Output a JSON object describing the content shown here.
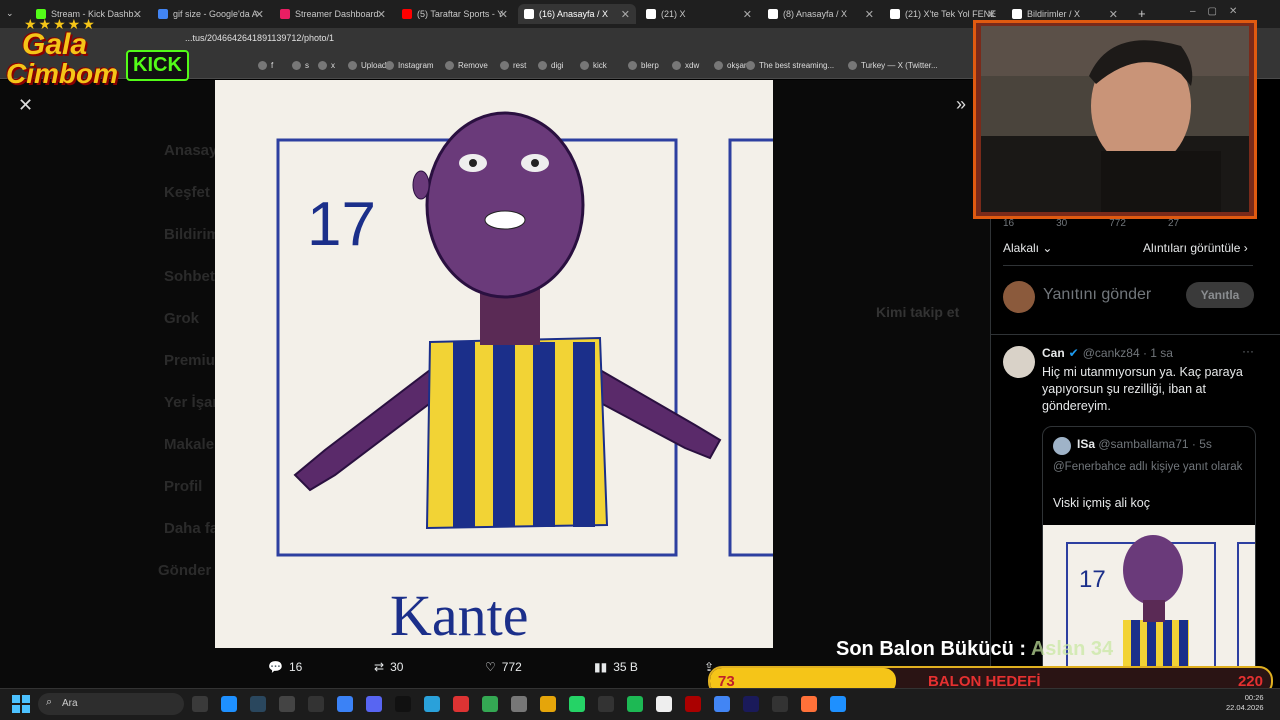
{
  "tabs": [
    {
      "label": "Stream - Kick Dashb...",
      "color": "#53fc18"
    },
    {
      "label": "gif size - Google'da A",
      "color": "#4285f4"
    },
    {
      "label": "Streamer Dashboard",
      "color": "#e91e63"
    },
    {
      "label": "(5) Taraftar Sports - Y",
      "color": "#ff0000"
    },
    {
      "label": "(16) Anasayfa / X",
      "color": "#ffffff"
    },
    {
      "label": "(21) X",
      "color": "#ffffff"
    },
    {
      "label": "(8) Anasayfa / X",
      "color": "#ffffff"
    },
    {
      "label": "(21) X'te Tek Yol FENE",
      "color": "#ffffff"
    },
    {
      "label": "Bildirimler / X",
      "color": "#ffffff"
    }
  ],
  "url": "...tus/2046642641891139712/photo/1",
  "bookmarks": [
    "f",
    "s",
    "x",
    "Upload",
    "Instagram",
    "Remove",
    "rest",
    "digi",
    "kick",
    "blerp",
    "xdw",
    "okşan",
    "The best streaming...",
    "Turkey — X (Twitter..."
  ],
  "logo": {
    "line1": "Gala",
    "line2": "Cimbom",
    "badge": "KICK"
  },
  "photo": {
    "number": "17",
    "caption": "Kante"
  },
  "sidebar": [
    "Anasayfa",
    "Keşfet",
    "Bildirimler",
    "Sohbet",
    "Grok",
    "Premium",
    "Yer İşaretleri",
    "Makaleler",
    "Profil",
    "Daha fazla",
    "Gönder"
  ],
  "stats": {
    "replies": "16",
    "reposts": "30",
    "likes": "772",
    "views": "35 B"
  },
  "right": {
    "mini_stats": [
      "16",
      "30",
      "772",
      "27"
    ],
    "filter": "Alakalı",
    "quotes_link": "Alıntıları görüntüle",
    "reply_placeholder": "Yanıtını gönder",
    "reply_button": "Yanıtla"
  },
  "tweet": {
    "name": "Can",
    "handle": "@cankz84 · 1 sa",
    "text": "Hiç mi utanmıyorsun ya. Kaç paraya yapıyorsun şu rezilliği, iban at göndereyim.",
    "quote": {
      "name": "ISa",
      "handle": "@samballama71 · 5s",
      "reply_to": "@Fenerbahce adlı kişiye yanıt olarak",
      "text": "Viski içmiş ali koç"
    }
  },
  "overlay": {
    "balon_title": "Son Balon Bükücü :",
    "balon_name": "Aslan 34",
    "left_num": "73",
    "goal_label": "BALON HEDEFİ",
    "goal_num": "220"
  },
  "taskbar": {
    "search": "Ara",
    "time": "00:26",
    "date": "22.04.2026"
  },
  "colors": {
    "accent": "#1d9bf0",
    "fener_navy": "#1b2f8a",
    "fener_yellow": "#f2d335",
    "overlay_green": "#c7e8a0",
    "overlay_red": "#e53030"
  }
}
